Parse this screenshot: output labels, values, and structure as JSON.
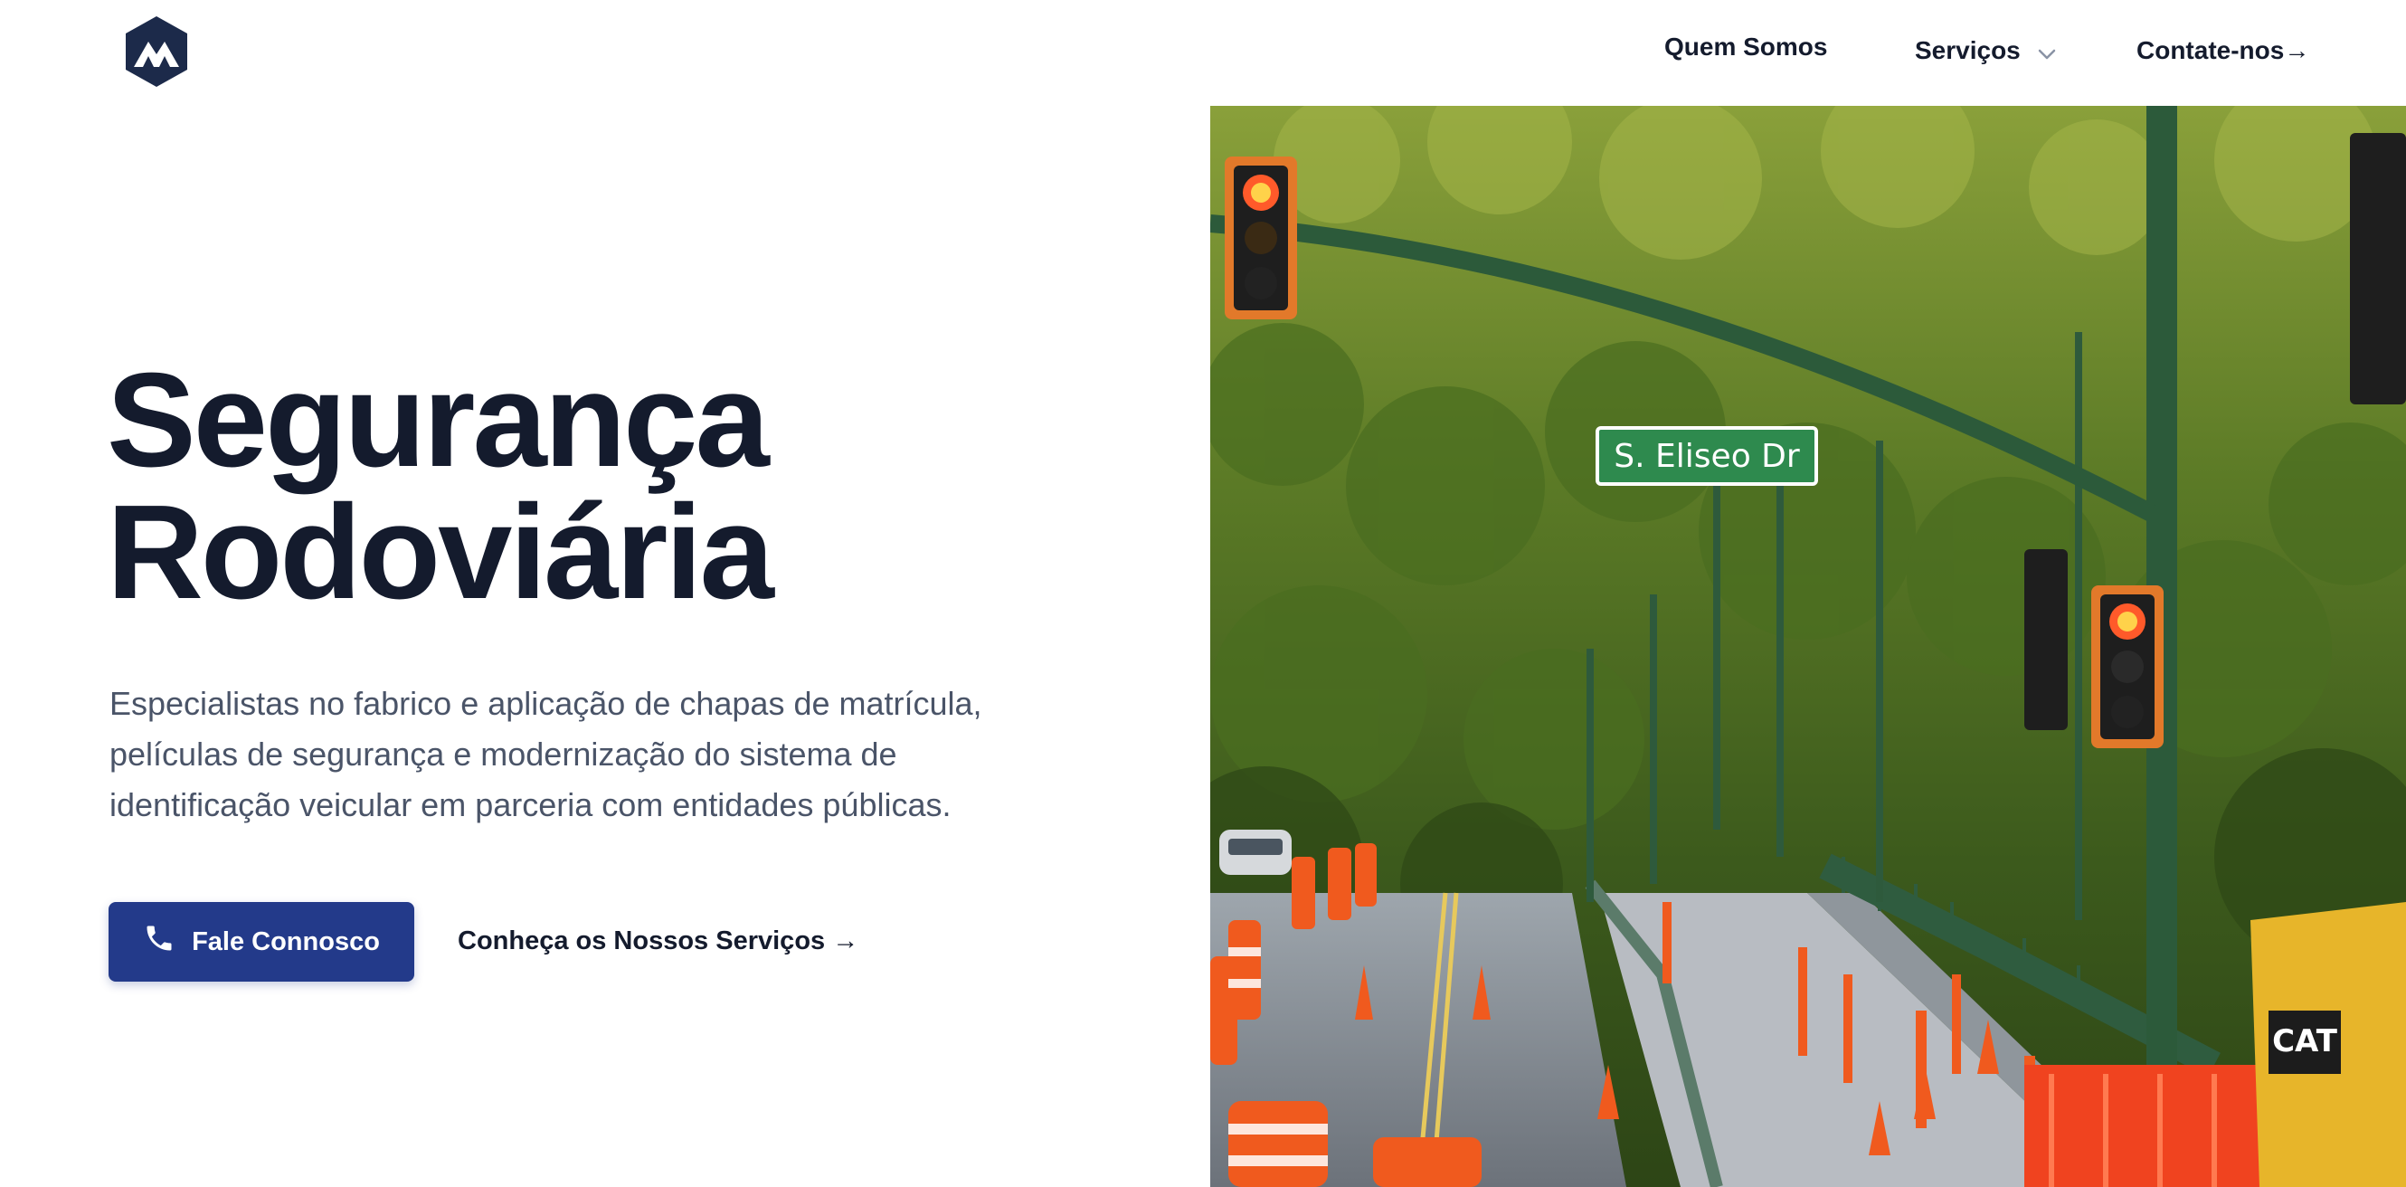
{
  "header": {
    "logo_icon": "mountain-hexagon-logo",
    "nav": {
      "about": "Quem Somos",
      "services": "Serviços",
      "services_icon": "chevron-down-icon",
      "contact": "Contate-nos→"
    }
  },
  "hero": {
    "title_line1": "Segurança",
    "title_line2": "Rodoviária",
    "description_lines": [
      "Especialistas no fabrico e aplicação de chapas de matrícula,",
      "películas de segurança e modernização do sistema de",
      "identificação veicular em parceria com entidades públicas."
    ],
    "cta_primary": {
      "label": "Fale Connosco",
      "icon": "phone-icon"
    },
    "cta_secondary": "Conheça os Nossos Serviços →",
    "image": {
      "street_sign": "S. Eliseo Dr",
      "alt_icon": "road-construction-photo"
    }
  },
  "colors": {
    "text_dark": "#141b2d",
    "text_muted": "#4a5468",
    "brand_blue": "#233a8a",
    "logo_navy": "#1c2a4a"
  }
}
